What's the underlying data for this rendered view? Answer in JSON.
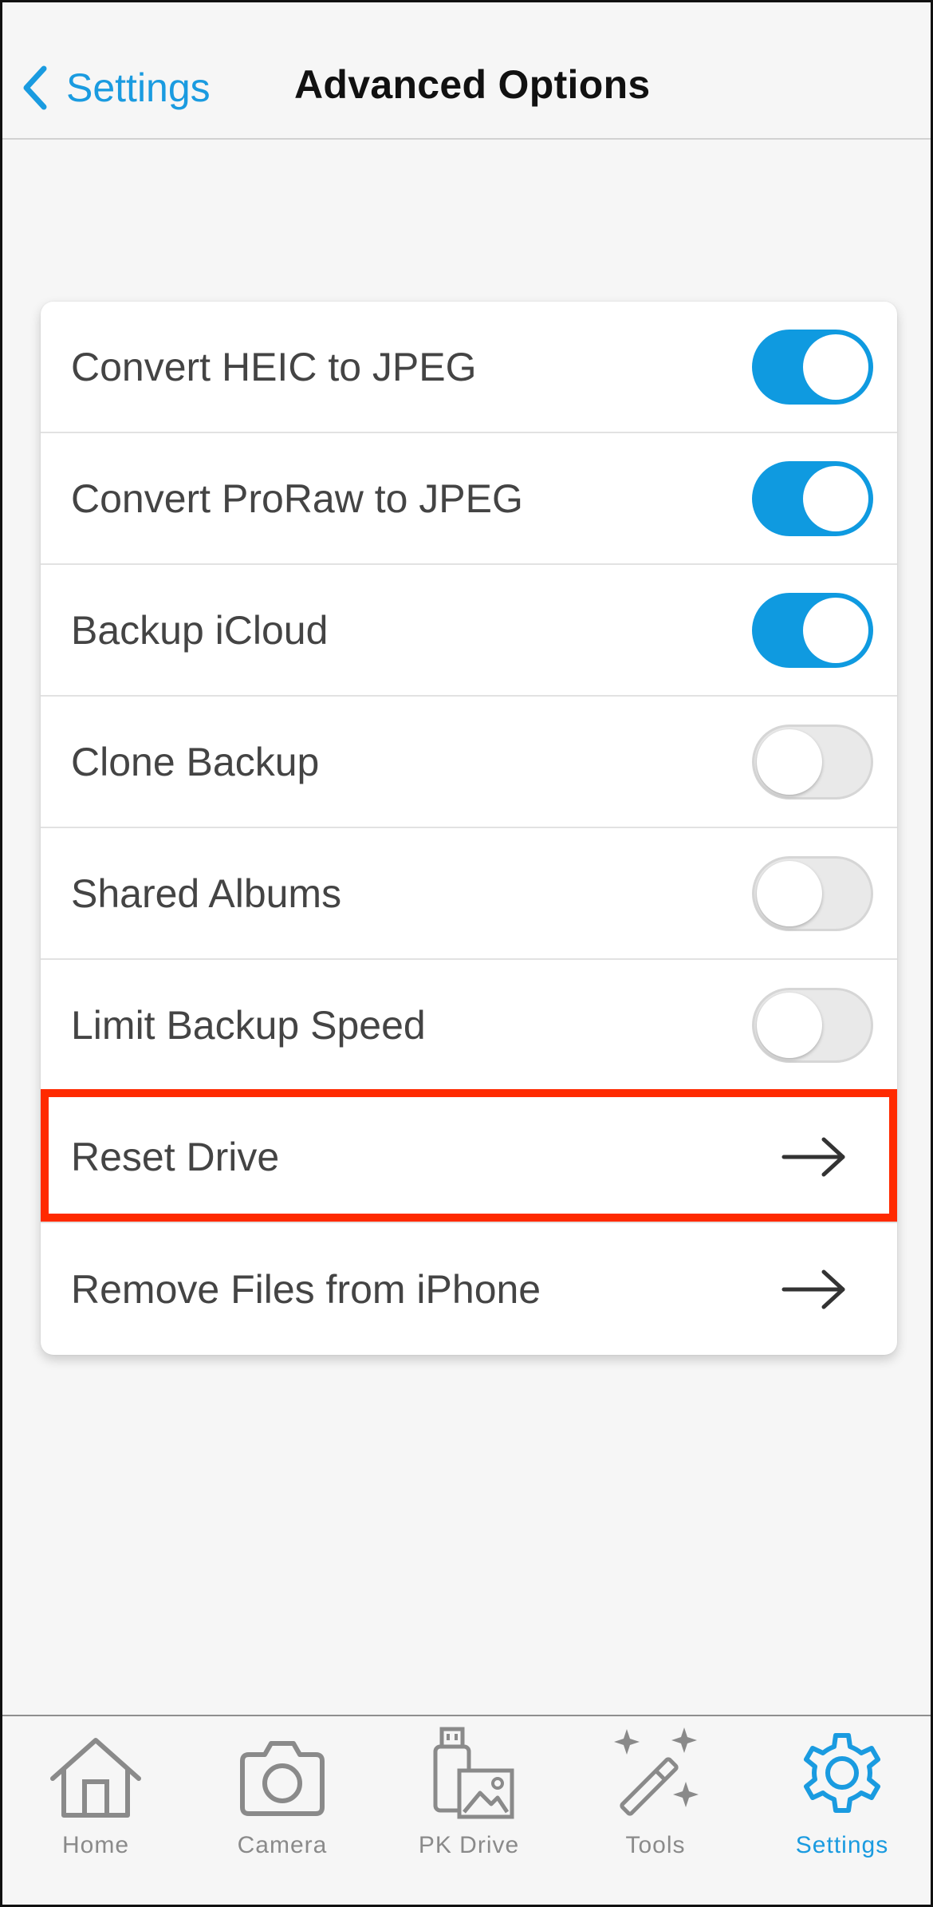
{
  "nav": {
    "back_label": "Settings",
    "title": "Advanced Options"
  },
  "options": [
    {
      "label": "Convert HEIC to JPEG",
      "type": "toggle",
      "on": true
    },
    {
      "label": "Convert ProRaw to JPEG",
      "type": "toggle",
      "on": true
    },
    {
      "label": "Backup iCloud",
      "type": "toggle",
      "on": true
    },
    {
      "label": "Clone Backup",
      "type": "toggle",
      "on": false
    },
    {
      "label": "Shared Albums",
      "type": "toggle",
      "on": false
    },
    {
      "label": "Limit Backup Speed",
      "type": "toggle",
      "on": false
    },
    {
      "label": "Reset Drive",
      "type": "link",
      "highlighted": true
    },
    {
      "label": "Remove Files from iPhone",
      "type": "link"
    }
  ],
  "tabs": [
    {
      "label": "Home",
      "icon": "house-icon"
    },
    {
      "label": "Camera",
      "icon": "camera-icon"
    },
    {
      "label": "PK Drive",
      "icon": "usb-drive-photo-icon"
    },
    {
      "label": "Tools",
      "icon": "magic-wand-icon"
    },
    {
      "label": "Settings",
      "icon": "gear-icon",
      "active": true
    }
  ],
  "colors": {
    "accent": "#1a9be0",
    "toggle_on": "#0f9ae0",
    "highlight": "#ff2a00",
    "inactive_tab": "#8a8a8a"
  }
}
